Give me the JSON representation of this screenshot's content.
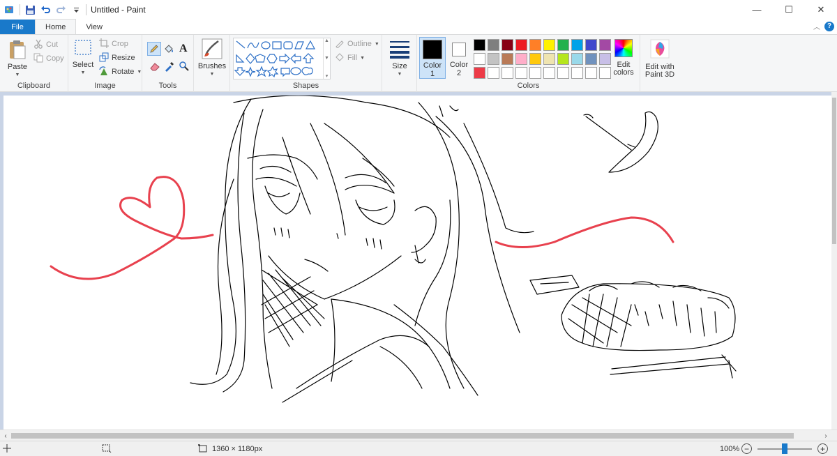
{
  "window": {
    "title": "Untitled - Paint",
    "minimize": "—",
    "maximize": "☐",
    "close": "✕"
  },
  "tabs": {
    "file": "File",
    "home": "Home",
    "view": "View"
  },
  "ribbon": {
    "clipboard": {
      "paste": "Paste",
      "cut": "Cut",
      "copy": "Copy",
      "label": "Clipboard"
    },
    "image": {
      "select": "Select",
      "crop": "Crop",
      "resize": "Resize",
      "rotate": "Rotate",
      "label": "Image"
    },
    "tools": {
      "text_tool": "A",
      "label": "Tools"
    },
    "brushes": {
      "label": "Brushes"
    },
    "shapes": {
      "outline": "Outline",
      "fill": "Fill",
      "label": "Shapes"
    },
    "size": {
      "label": "Size"
    },
    "color1": {
      "line1": "Color",
      "line2": "1",
      "value": "#000000"
    },
    "color2": {
      "line1": "Color",
      "line2": "2",
      "value": "#ffffff"
    },
    "colors": {
      "label": "Colors",
      "edit_line1": "Edit",
      "edit_line2": "colors",
      "palette": [
        "#000000",
        "#7f7f7f",
        "#880015",
        "#ed1c24",
        "#ff7f27",
        "#fff200",
        "#22b14c",
        "#00a2e8",
        "#3f48cc",
        "#a349a4",
        "#ffffff",
        "#c3c3c3",
        "#b97a57",
        "#ffaec9",
        "#ffc90e",
        "#efe4b0",
        "#b5e61d",
        "#99d9ea",
        "#7092be",
        "#c8bfe7",
        "#ed3b47",
        "#ffffff",
        "#ffffff",
        "#ffffff",
        "#ffffff",
        "#ffffff",
        "#ffffff",
        "#ffffff",
        "#ffffff",
        "#ffffff"
      ]
    },
    "paint3d": {
      "line1": "Edit with",
      "line2": "Paint 3D"
    }
  },
  "canvas": {
    "stroke_color": "#000000",
    "accent_color": "#e8414e"
  },
  "status": {
    "image_size": "1360 × 1180px",
    "zoom": "100%",
    "zoom_fraction": 0.5
  }
}
